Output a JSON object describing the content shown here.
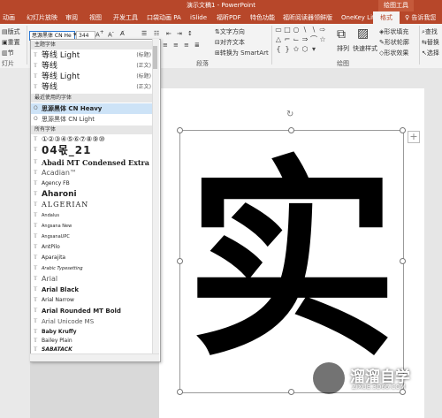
{
  "window": {
    "title": "演示文稿1 - PowerPoint",
    "context_label": "绘图工具"
  },
  "tabs": [
    {
      "label": "动画"
    },
    {
      "label": "幻灯片放映"
    },
    {
      "label": "审阅"
    },
    {
      "label": "视图"
    },
    {
      "label": "开发工具"
    },
    {
      "label": "口袋动画 PA"
    },
    {
      "label": "iSlide"
    },
    {
      "label": "福昕PDF"
    },
    {
      "label": "特色功能"
    },
    {
      "label": "福昕阅读器领鲜版"
    },
    {
      "label": "OneKey Lite"
    },
    {
      "label": "格式"
    }
  ],
  "tell_me": "告诉我您",
  "ribbon": {
    "layout_label": "版式",
    "reset_label": "重置",
    "section_label": "节",
    "slides_group": "灯片",
    "font_name": "思源黑体 CN He",
    "font_size": "344",
    "text_direction": "文字方向",
    "align_text": "对齐文本",
    "convert_smartart": "转换为 SmartArt",
    "paragraph_group": "段落",
    "arrange": "排列",
    "quick_styles": "快速样式",
    "shape_fill": "形状填充",
    "shape_outline": "形状轮廓",
    "shape_effects": "形状效果",
    "drawing_group": "绘图",
    "find": "查找",
    "replace": "替换",
    "select": "选择"
  },
  "font_dropdown": {
    "theme_header": "主题字体",
    "theme_fonts": [
      {
        "name": "等线 Light",
        "tag": "(标题)"
      },
      {
        "name": "等线",
        "tag": "(正文)"
      },
      {
        "name": "等线 Light",
        "tag": "(标题)"
      },
      {
        "name": "等线",
        "tag": "(正文)"
      }
    ],
    "recent_header": "最近使用的字体",
    "recent_fonts": [
      {
        "name": "思源黑体 CN Heavy"
      },
      {
        "name": "思源黑体 CN Light"
      }
    ],
    "all_header": "所有字体",
    "all_fonts": [
      {
        "name": "①②③④⑤⑥⑦⑧⑨⑩"
      },
      {
        "name": "04몫_21"
      },
      {
        "name": "Abadi MT Condensed Extra Bold"
      },
      {
        "name": "Acadian™"
      },
      {
        "name": "Agency FB"
      },
      {
        "name": "Aharoni"
      },
      {
        "name": "ALGERIAN"
      },
      {
        "name": "Andalus"
      },
      {
        "name": "Angsana New"
      },
      {
        "name": "AngsanaUPC"
      },
      {
        "name": "AntPilo"
      },
      {
        "name": "Aparajita"
      },
      {
        "name": "Arabic Typesetting"
      },
      {
        "name": "Arial"
      },
      {
        "name": "Arial Black"
      },
      {
        "name": "Arial Narrow"
      },
      {
        "name": "Arial Rounded MT Bold"
      },
      {
        "name": "Arial Unicode MS"
      },
      {
        "name": "Baby Kruffy"
      },
      {
        "name": "Bailey Plain"
      },
      {
        "name": "SABATACK"
      }
    ]
  },
  "slide": {
    "text": "实"
  },
  "watermark": {
    "brand": "溜溜自学",
    "url": "ZIXUE.3D66.COM"
  }
}
